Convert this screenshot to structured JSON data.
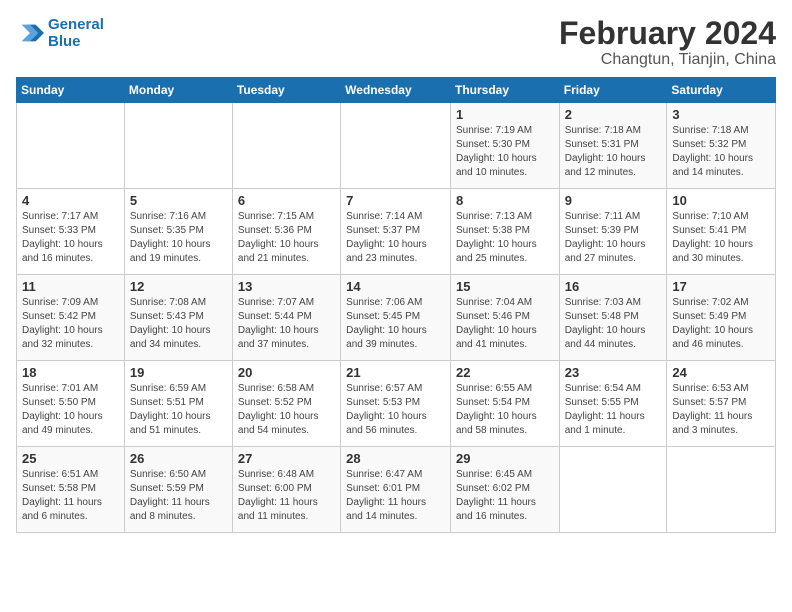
{
  "logo": {
    "line1": "General",
    "line2": "Blue"
  },
  "title": "February 2024",
  "subtitle": "Changtun, Tianjin, China",
  "days_of_week": [
    "Sunday",
    "Monday",
    "Tuesday",
    "Wednesday",
    "Thursday",
    "Friday",
    "Saturday"
  ],
  "weeks": [
    [
      {
        "day": "",
        "info": ""
      },
      {
        "day": "",
        "info": ""
      },
      {
        "day": "",
        "info": ""
      },
      {
        "day": "",
        "info": ""
      },
      {
        "day": "1",
        "info": "Sunrise: 7:19 AM\nSunset: 5:30 PM\nDaylight: 10 hours\nand 10 minutes."
      },
      {
        "day": "2",
        "info": "Sunrise: 7:18 AM\nSunset: 5:31 PM\nDaylight: 10 hours\nand 12 minutes."
      },
      {
        "day": "3",
        "info": "Sunrise: 7:18 AM\nSunset: 5:32 PM\nDaylight: 10 hours\nand 14 minutes."
      }
    ],
    [
      {
        "day": "4",
        "info": "Sunrise: 7:17 AM\nSunset: 5:33 PM\nDaylight: 10 hours\nand 16 minutes."
      },
      {
        "day": "5",
        "info": "Sunrise: 7:16 AM\nSunset: 5:35 PM\nDaylight: 10 hours\nand 19 minutes."
      },
      {
        "day": "6",
        "info": "Sunrise: 7:15 AM\nSunset: 5:36 PM\nDaylight: 10 hours\nand 21 minutes."
      },
      {
        "day": "7",
        "info": "Sunrise: 7:14 AM\nSunset: 5:37 PM\nDaylight: 10 hours\nand 23 minutes."
      },
      {
        "day": "8",
        "info": "Sunrise: 7:13 AM\nSunset: 5:38 PM\nDaylight: 10 hours\nand 25 minutes."
      },
      {
        "day": "9",
        "info": "Sunrise: 7:11 AM\nSunset: 5:39 PM\nDaylight: 10 hours\nand 27 minutes."
      },
      {
        "day": "10",
        "info": "Sunrise: 7:10 AM\nSunset: 5:41 PM\nDaylight: 10 hours\nand 30 minutes."
      }
    ],
    [
      {
        "day": "11",
        "info": "Sunrise: 7:09 AM\nSunset: 5:42 PM\nDaylight: 10 hours\nand 32 minutes."
      },
      {
        "day": "12",
        "info": "Sunrise: 7:08 AM\nSunset: 5:43 PM\nDaylight: 10 hours\nand 34 minutes."
      },
      {
        "day": "13",
        "info": "Sunrise: 7:07 AM\nSunset: 5:44 PM\nDaylight: 10 hours\nand 37 minutes."
      },
      {
        "day": "14",
        "info": "Sunrise: 7:06 AM\nSunset: 5:45 PM\nDaylight: 10 hours\nand 39 minutes."
      },
      {
        "day": "15",
        "info": "Sunrise: 7:04 AM\nSunset: 5:46 PM\nDaylight: 10 hours\nand 41 minutes."
      },
      {
        "day": "16",
        "info": "Sunrise: 7:03 AM\nSunset: 5:48 PM\nDaylight: 10 hours\nand 44 minutes."
      },
      {
        "day": "17",
        "info": "Sunrise: 7:02 AM\nSunset: 5:49 PM\nDaylight: 10 hours\nand 46 minutes."
      }
    ],
    [
      {
        "day": "18",
        "info": "Sunrise: 7:01 AM\nSunset: 5:50 PM\nDaylight: 10 hours\nand 49 minutes."
      },
      {
        "day": "19",
        "info": "Sunrise: 6:59 AM\nSunset: 5:51 PM\nDaylight: 10 hours\nand 51 minutes."
      },
      {
        "day": "20",
        "info": "Sunrise: 6:58 AM\nSunset: 5:52 PM\nDaylight: 10 hours\nand 54 minutes."
      },
      {
        "day": "21",
        "info": "Sunrise: 6:57 AM\nSunset: 5:53 PM\nDaylight: 10 hours\nand 56 minutes."
      },
      {
        "day": "22",
        "info": "Sunrise: 6:55 AM\nSunset: 5:54 PM\nDaylight: 10 hours\nand 58 minutes."
      },
      {
        "day": "23",
        "info": "Sunrise: 6:54 AM\nSunset: 5:55 PM\nDaylight: 11 hours\nand 1 minute."
      },
      {
        "day": "24",
        "info": "Sunrise: 6:53 AM\nSunset: 5:57 PM\nDaylight: 11 hours\nand 3 minutes."
      }
    ],
    [
      {
        "day": "25",
        "info": "Sunrise: 6:51 AM\nSunset: 5:58 PM\nDaylight: 11 hours\nand 6 minutes."
      },
      {
        "day": "26",
        "info": "Sunrise: 6:50 AM\nSunset: 5:59 PM\nDaylight: 11 hours\nand 8 minutes."
      },
      {
        "day": "27",
        "info": "Sunrise: 6:48 AM\nSunset: 6:00 PM\nDaylight: 11 hours\nand 11 minutes."
      },
      {
        "day": "28",
        "info": "Sunrise: 6:47 AM\nSunset: 6:01 PM\nDaylight: 11 hours\nand 14 minutes."
      },
      {
        "day": "29",
        "info": "Sunrise: 6:45 AM\nSunset: 6:02 PM\nDaylight: 11 hours\nand 16 minutes."
      },
      {
        "day": "",
        "info": ""
      },
      {
        "day": "",
        "info": ""
      }
    ]
  ]
}
